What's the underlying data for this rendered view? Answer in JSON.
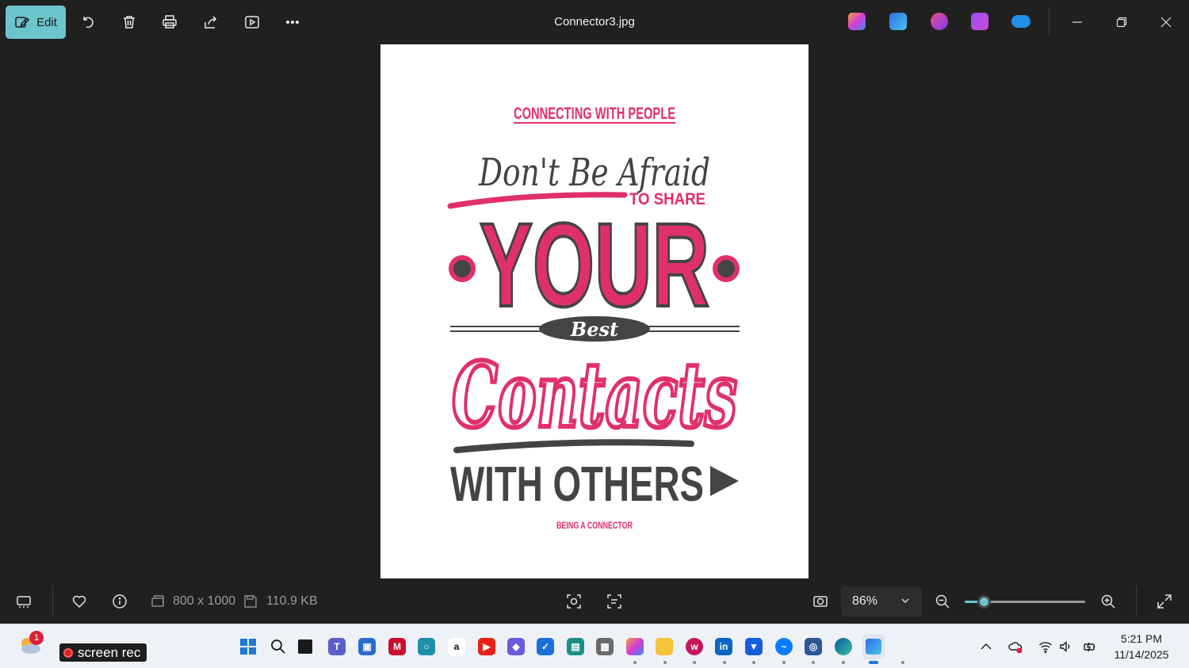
{
  "toolbar": {
    "edit_label": "Edit",
    "file_title": "Connector3.jpg"
  },
  "poster": {
    "header": "CONNECTING WITH PEOPLE",
    "line1": "Don't Be  Afraid",
    "to_share": "TO SHARE",
    "your": "YOUR",
    "best": "Best",
    "contacts": "Contacts",
    "with_others": "WITH OTHERS",
    "footer": "BEING A CONNECTOR",
    "colors": {
      "pink": "#e0306a",
      "dark": "#444444"
    }
  },
  "status": {
    "dimensions": "800 x 1000",
    "file_size": "110.9 KB",
    "zoom_value": "86%",
    "zoom_fraction": 0.16
  },
  "taskbar": {
    "screenrec_label": "screen rec",
    "weather_badge": "1",
    "time": "5:21 PM",
    "date": "11/14/2025"
  },
  "colors": {
    "accent": "#6cc4cc",
    "background": "#202020",
    "taskbar": "#eef2f7"
  }
}
